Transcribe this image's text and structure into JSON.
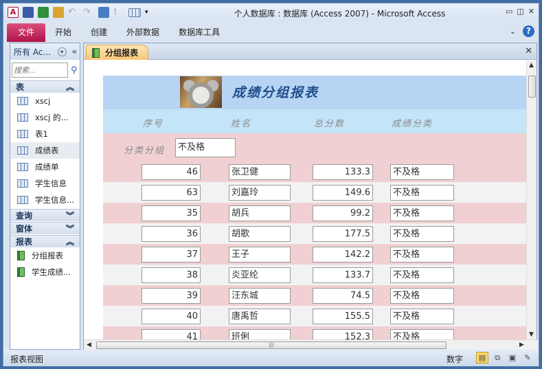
{
  "window": {
    "title": "个人数据库 : 数据库 (Access 2007)  -  Microsoft Access"
  },
  "ribbon": {
    "tabs": [
      "文件",
      "开始",
      "创建",
      "外部数据",
      "数据库工具"
    ]
  },
  "nav": {
    "header": "所有 Ac...",
    "search_placeholder": "搜索...",
    "sections": [
      {
        "label": "表",
        "expanded": true,
        "items": [
          "xscj",
          "xscj 的...",
          "表1",
          "成绩表",
          "成绩单",
          "学生信息",
          "学生信息..."
        ]
      },
      {
        "label": "查询",
        "expanded": false,
        "items": []
      },
      {
        "label": "窗体",
        "expanded": false,
        "items": []
      },
      {
        "label": "报表",
        "expanded": true,
        "items": [
          "分组报表",
          "学生成绩..."
        ]
      }
    ],
    "selected_item": "成绩表"
  },
  "document": {
    "tab_label": "分组报表"
  },
  "report": {
    "title": "成绩分组报表",
    "columns": [
      "序号",
      "姓名",
      "总分数",
      "成绩分类"
    ],
    "group_label": "分类分组",
    "group_value": "不及格",
    "rows": [
      [
        "46",
        "张卫健",
        "133.3",
        "不及格"
      ],
      [
        "63",
        "刘嘉玲",
        "149.6",
        "不及格"
      ],
      [
        "35",
        "胡兵",
        "99.2",
        "不及格"
      ],
      [
        "36",
        "胡歌",
        "177.5",
        "不及格"
      ],
      [
        "37",
        "王子",
        "142.2",
        "不及格"
      ],
      [
        "38",
        "炎亚纶",
        "133.7",
        "不及格"
      ],
      [
        "39",
        "汪东城",
        "74.5",
        "不及格"
      ],
      [
        "40",
        "唐禹哲",
        "155.5",
        "不及格"
      ],
      [
        "41",
        "班俐",
        "152.3",
        "不及格"
      ]
    ],
    "row_colors": [
      "#f0d0d2",
      "#f2f2f2"
    ]
  },
  "status": {
    "left": "报表视图",
    "mode": "数字"
  }
}
